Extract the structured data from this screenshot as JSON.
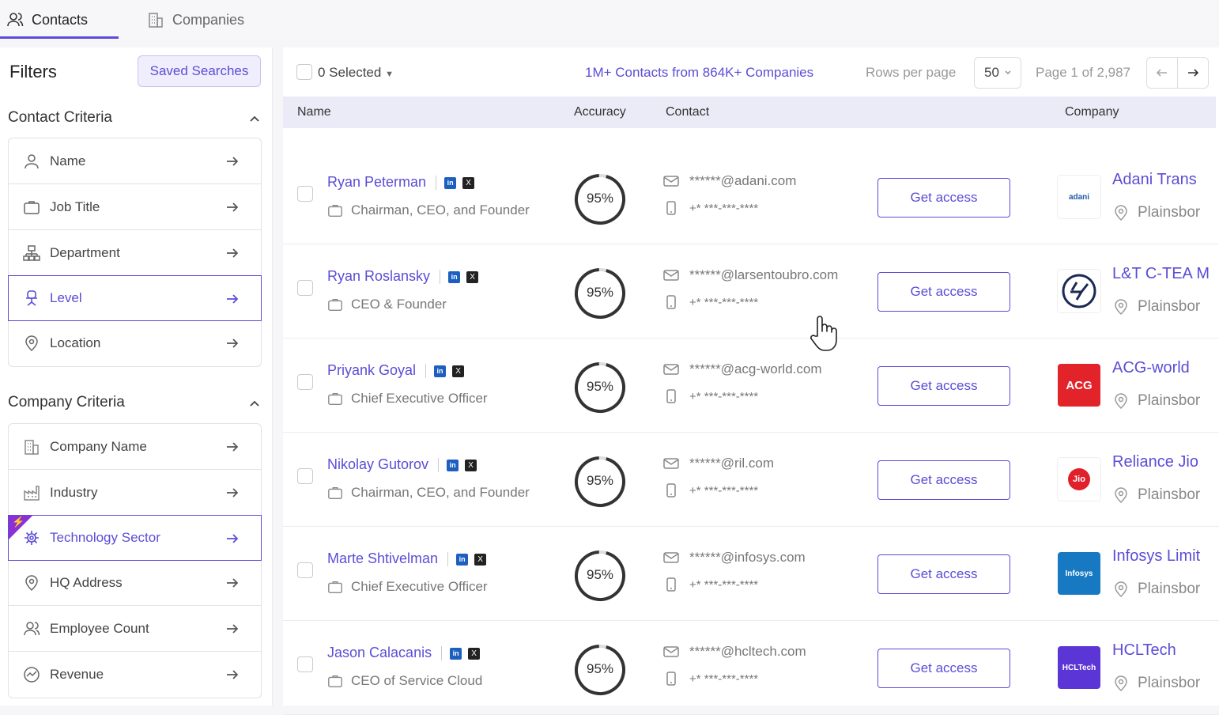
{
  "tabs": [
    {
      "label": "Contacts",
      "icon": "contacts-icon"
    },
    {
      "label": "Companies",
      "icon": "building-icon"
    }
  ],
  "sidebar": {
    "filters_title": "Filters",
    "saved_searches_label": "Saved Searches",
    "contact_criteria": {
      "title": "Contact Criteria",
      "items": [
        {
          "label": "Name",
          "icon": "person-icon"
        },
        {
          "label": "Job Title",
          "icon": "briefcase-icon"
        },
        {
          "label": "Department",
          "icon": "department-icon"
        },
        {
          "label": "Level",
          "icon": "chair-icon"
        },
        {
          "label": "Location",
          "icon": "location-pin-icon"
        }
      ]
    },
    "company_criteria": {
      "title": "Company Criteria",
      "items": [
        {
          "label": "Company Name",
          "icon": "building-icon"
        },
        {
          "label": "Industry",
          "icon": "factory-icon"
        },
        {
          "label": "Technology Sector",
          "icon": "chip-icon"
        },
        {
          "label": "HQ Address",
          "icon": "location-pin-icon"
        },
        {
          "label": "Employee Count",
          "icon": "people-icon"
        },
        {
          "label": "Revenue",
          "icon": "revenue-icon"
        }
      ]
    }
  },
  "toolbar": {
    "selected_label": "0 Selected",
    "count_label": "1M+ Contacts from 864K+ Companies",
    "rows_per_page_label": "Rows per page",
    "rows_per_page_value": "50",
    "page_label": "Page 1 of 2,987"
  },
  "table": {
    "headers": {
      "name": "Name",
      "accuracy": "Accuracy",
      "contact": "Contact",
      "company": "Company"
    },
    "get_access_label": "Get access",
    "linkedin_label": "in",
    "x_label": "X",
    "rows": [
      {
        "name": "Ryan Peterman",
        "title": "Chairman, CEO, and Founder",
        "accuracy": "95%",
        "email": "******@adani.com",
        "phone": "+* ***-***-****",
        "company": "Adani Trans",
        "location": "Plainsbor",
        "logo_text": "adani",
        "logo_bg": "#ffffff",
        "logo_fg": "#1f5aa6"
      },
      {
        "name": "Ryan Roslansky",
        "title": "CEO & Founder",
        "accuracy": "95%",
        "email": "******@larsentoubro.com",
        "phone": "+* ***-***-****",
        "company": "L&T C-TEA M",
        "location": "Plainsbor",
        "logo_text": "L&T",
        "logo_bg": "#ffffff",
        "logo_fg": "#1b2a55"
      },
      {
        "name": "Priyank Goyal",
        "title": "Chief Executive Officer",
        "accuracy": "95%",
        "email": "******@acg-world.com",
        "phone": "+* ***-***-****",
        "company": "ACG-world",
        "location": "Plainsbor",
        "logo_text": "ACG",
        "logo_bg": "#e2232a",
        "logo_fg": "#ffffff"
      },
      {
        "name": "Nikolay Gutorov",
        "title": "Chairman, CEO, and Founder",
        "accuracy": "95%",
        "email": "******@ril.com",
        "phone": "+* ***-***-****",
        "company": "Reliance Jio",
        "location": "Plainsbor",
        "logo_text": "Jio",
        "logo_bg": "#ffffff",
        "logo_fg": "#ffffff"
      },
      {
        "name": "Marte Shtivelman",
        "title": "Chief Executive Officer",
        "accuracy": "95%",
        "email": "******@infosys.com",
        "phone": "+* ***-***-****",
        "company": "Infosys Limit",
        "location": "Plainsbor",
        "logo_text": "Infosys",
        "logo_bg": "#1679c2",
        "logo_fg": "#ffffff"
      },
      {
        "name": "Jason Calacanis",
        "title": "CEO of Service Cloud",
        "accuracy": "95%",
        "email": "******@hcltech.com",
        "phone": "+* ***-***-****",
        "company": "HCLTech",
        "location": "Plainsbor",
        "logo_text": "HCLTech",
        "logo_bg": "#5b35d6",
        "logo_fg": "#ffffff"
      }
    ]
  },
  "colors": {
    "accent": "#5b4dd6",
    "header_bg": "#ebebf7",
    "bolt": "#8b2fd6"
  }
}
